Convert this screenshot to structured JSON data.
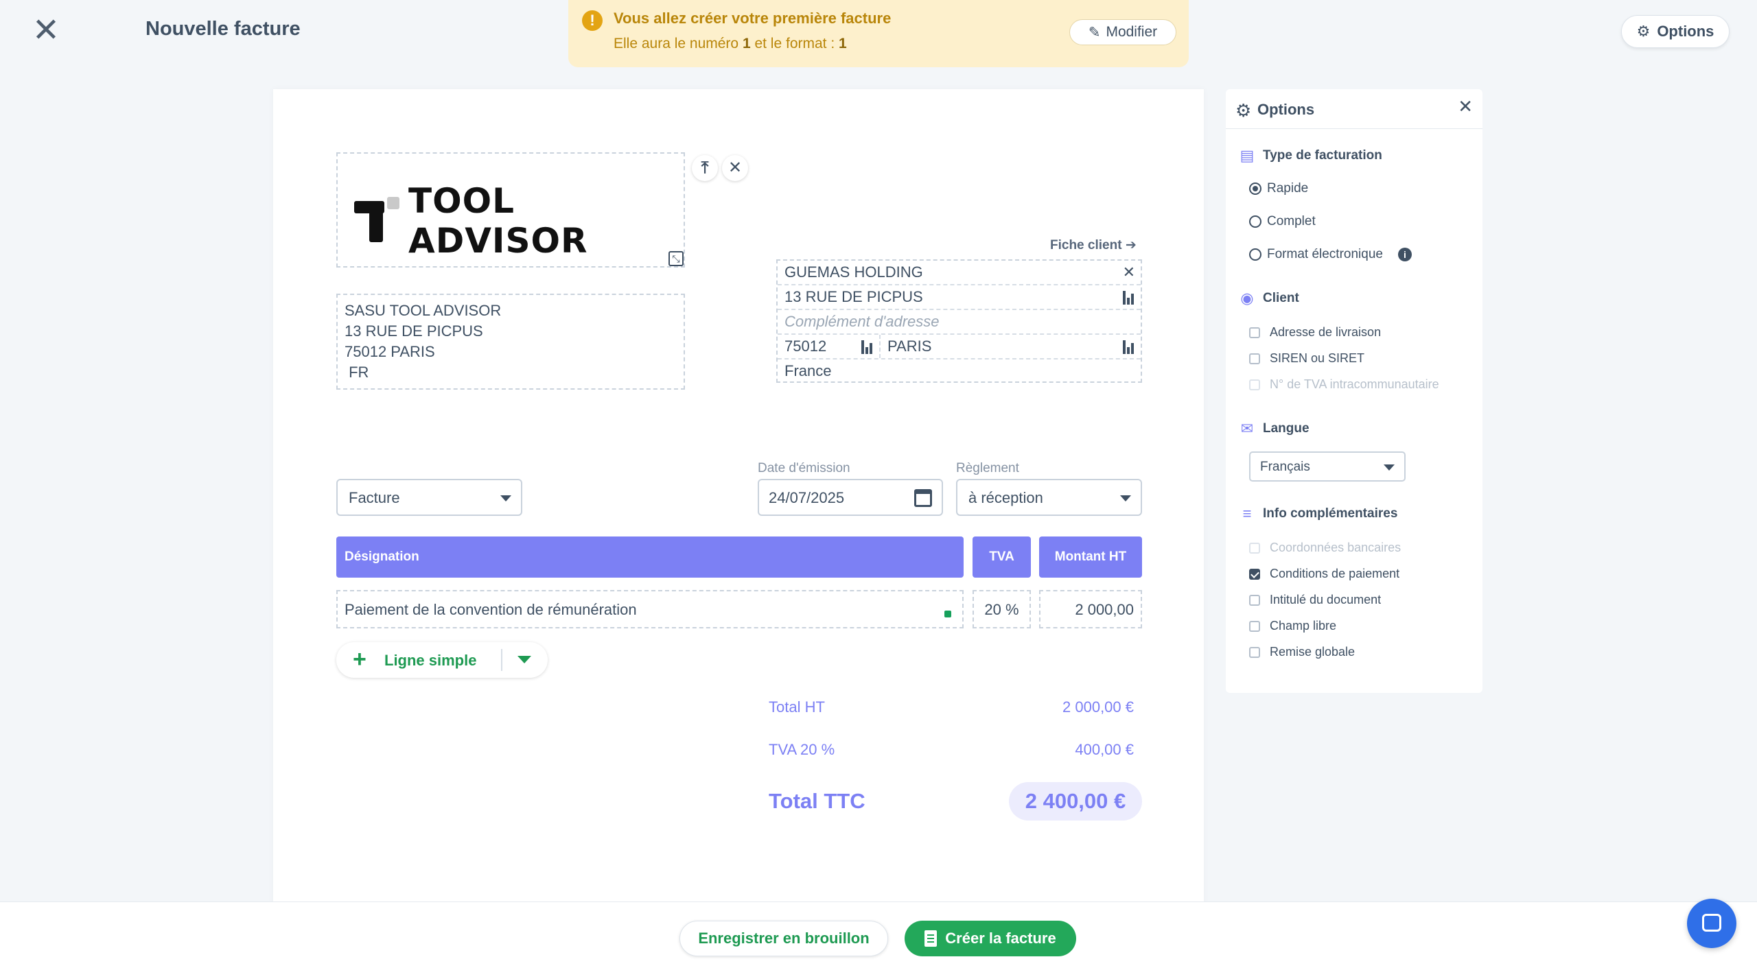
{
  "header": {
    "title": "Nouvelle facture",
    "options_label": "Options"
  },
  "notice": {
    "title": "Vous allez créer votre première facture",
    "sub_prefix": "Elle aura le numéro ",
    "number": "1",
    "sub_mid": " et le format : ",
    "format": "1",
    "modify_label": "Modifier"
  },
  "logo": {
    "text": "TOOL ADVISOR"
  },
  "company": {
    "line1": "SASU TOOL ADVISOR",
    "line2": "13 RUE DE PICPUS",
    "line3": "75012 PARIS",
    "line4": " FR"
  },
  "client": {
    "link_label": "Fiche client",
    "name": "GUEMAS HOLDING",
    "address": "13 RUE DE PICPUS",
    "complement_placeholder": "Complément d'adresse",
    "zip": "75012",
    "city": "PARIS",
    "country": "France"
  },
  "document": {
    "type_value": "Facture",
    "date_label": "Date d'émission",
    "date_value": "24/07/2025",
    "payment_label": "Règlement",
    "payment_value": "à réception"
  },
  "table": {
    "headers": {
      "designation": "Désignation",
      "tva": "TVA",
      "montant": "Montant HT"
    },
    "rows": [
      {
        "designation": "Paiement de la convention de rémunération",
        "tva": "20 %",
        "montant": "2 000,00"
      }
    ],
    "add_line_label": "Ligne simple"
  },
  "totals": {
    "ht_label": "Total HT",
    "ht_value": "2 000,00 €",
    "tva_label": "TVA 20 %",
    "tva_value": "400,00 €",
    "ttc_label": "Total TTC",
    "ttc_value": "2 400,00 €"
  },
  "options_panel": {
    "title": "Options",
    "billing_type": {
      "title": "Type de facturation",
      "options": [
        "Rapide",
        "Complet",
        "Format électronique"
      ],
      "selected": "Rapide"
    },
    "client": {
      "title": "Client",
      "items": [
        {
          "label": "Adresse de livraison",
          "checked": false,
          "disabled": false
        },
        {
          "label": "SIREN ou SIRET",
          "checked": false,
          "disabled": false
        },
        {
          "label": "N° de TVA intracommunautaire",
          "checked": false,
          "disabled": true
        }
      ]
    },
    "language": {
      "title": "Langue",
      "value": "Français"
    },
    "extra_info": {
      "title": "Info complémentaires",
      "items": [
        {
          "label": "Coordonnées bancaires",
          "checked": false,
          "disabled": true
        },
        {
          "label": "Conditions de paiement",
          "checked": true,
          "disabled": false
        },
        {
          "label": "Intitulé du document",
          "checked": false,
          "disabled": false
        },
        {
          "label": "Champ libre",
          "checked": false,
          "disabled": false
        },
        {
          "label": "Remise globale",
          "checked": false,
          "disabled": false
        }
      ]
    }
  },
  "footer": {
    "draft_label": "Enregistrer en brouillon",
    "create_label": "Créer la facture"
  },
  "colors": {
    "accent": "#7c80f4",
    "primary_green": "#23a85a",
    "notice_bg": "#fdf0cc",
    "notice_text": "#b9860a",
    "chat_blue": "#2f6fe8"
  },
  "icons": {
    "close": "close-icon",
    "warning": "warning-icon",
    "pencil": "pencil-icon",
    "gear": "gear-icon",
    "upload": "upload-icon",
    "expand": "expand-icon",
    "calendar": "calendar-icon",
    "chat": "chat-icon"
  }
}
